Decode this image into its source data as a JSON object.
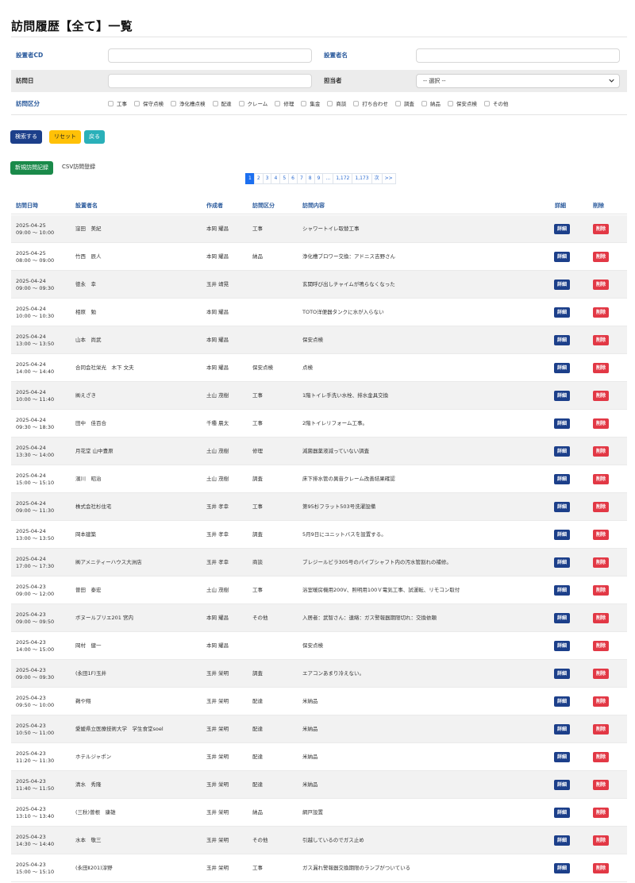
{
  "page": {
    "title": "訪問履歴【全て】一覧"
  },
  "filters": {
    "setter_cd_label": "設置者CD",
    "setter_name_label": "設置者名",
    "visit_date_label": "訪問日",
    "staff_label": "担当者",
    "staff_select": "-- 選択 --",
    "type_label": "訪問区分",
    "types": [
      "工事",
      "保守点検",
      "浄化槽点検",
      "配達",
      "クレーム",
      "修理",
      "集金",
      "商談",
      "打ち合わせ",
      "調査",
      "納品",
      "保安点検",
      "その他"
    ]
  },
  "actions": {
    "search": "検索する",
    "reset": "リセット",
    "back": "戻る",
    "new": "新規訪問記録",
    "csv": "CSV訪問登録"
  },
  "pagination": [
    "1",
    "2",
    "3",
    "4",
    "5",
    "6",
    "7",
    "8",
    "9",
    "...",
    "1,172",
    "1,173",
    "次",
    ">>"
  ],
  "table": {
    "headers": [
      "訪問日時",
      "設置者名",
      "作成者",
      "訪問区分",
      "訪問内容",
      "詳細",
      "削除"
    ],
    "detail_label": "詳細",
    "delete_label": "削除",
    "rows": [
      {
        "date": "2025-04-25",
        "time": "09:00 ～ 10:00",
        "name": "窪田　美紀",
        "author": "本岡 耀昌",
        "type": "工事",
        "content": "シャワートイレ取替工事"
      },
      {
        "date": "2025-04-25",
        "time": "08:00 ～ 09:00",
        "name": "竹西　辰人",
        "author": "本岡 耀昌",
        "type": "納品",
        "content": "浄化槽ブロワー交換：アドニス吉野さん"
      },
      {
        "date": "2025-04-24",
        "time": "09:00 ～ 09:30",
        "name": "徳永　幸",
        "author": "玉井 靖晃",
        "type": "",
        "content": "玄関呼び出しチャイムが鳴らなくなった"
      },
      {
        "date": "2025-04-24",
        "time": "10:00 ～ 10:30",
        "name": "相原　勉",
        "author": "本岡 耀昌",
        "type": "",
        "content": "TOTO洋便器タンクに水が入らない"
      },
      {
        "date": "2025-04-24",
        "time": "13:00 ～ 13:50",
        "name": "山本　尚武",
        "author": "本岡 耀昌",
        "type": "",
        "content": "保安点検"
      },
      {
        "date": "2025-04-24",
        "time": "14:00 ～ 14:40",
        "name": "合同会社栄光　木下 文夫",
        "author": "本岡 耀昌",
        "type": "保安点検",
        "content": "点検"
      },
      {
        "date": "2025-04-24",
        "time": "10:00 ～ 11:40",
        "name": "㈱えざき",
        "author": "土山 茂樹",
        "type": "工事",
        "content": "1階トイレ手洗い水栓、排水金具交換"
      },
      {
        "date": "2025-04-24",
        "time": "09:30 ～ 18:30",
        "name": "田中　佳百合",
        "author": "千種 晨太",
        "type": "工事",
        "content": "2階トイレリフォーム工事。"
      },
      {
        "date": "2025-04-24",
        "time": "13:30 ～ 14:00",
        "name": "月花堂 山中豊原",
        "author": "土山 茂樹",
        "type": "修理",
        "content": "減菌器薬液減っていない調査"
      },
      {
        "date": "2025-04-24",
        "time": "15:00 ～ 15:10",
        "name": "濱川　昭治",
        "author": "土山 茂樹",
        "type": "調査",
        "content": "床下排水管の異音クレーム改善結果確認"
      },
      {
        "date": "2025-04-24",
        "time": "09:00 ～ 11:30",
        "name": "株式会社杉住宅",
        "author": "玉井 孝幸",
        "type": "工事",
        "content": "第95杉フラット503号洗濯設備"
      },
      {
        "date": "2025-04-24",
        "time": "13:00 ～ 13:50",
        "name": "岡本建築",
        "author": "玉井 孝幸",
        "type": "調査",
        "content": "5月9日にユニットバスを設置する。"
      },
      {
        "date": "2025-04-24",
        "time": "17:00 ～ 17:30",
        "name": "㈱アメニティーハウス大洲店",
        "author": "玉井 孝幸",
        "type": "商談",
        "content": "ブレジールビラ305号のパイプシャフト内の汚水管割れの補修。"
      },
      {
        "date": "2025-04-23",
        "time": "09:00 ～ 12:00",
        "name": "曽田　泰宏",
        "author": "土山 茂樹",
        "type": "工事",
        "content": "浴室暖房機用200V、照明用100Ｖ電気工事、試運転、リモコン取付"
      },
      {
        "date": "2025-04-23",
        "time": "09:00 ～ 09:50",
        "name": "ボヌールプリエ201 宮内",
        "author": "本岡 耀昌",
        "type": "その他",
        "content": "入居者：武智さん：連絡：ガス警報器期限切れ：交換依頼"
      },
      {
        "date": "2025-04-23",
        "time": "14:00 ～ 15:00",
        "name": "岡村　健一",
        "author": "本岡 耀昌",
        "type": "",
        "content": "保安点検"
      },
      {
        "date": "2025-04-23",
        "time": "09:00 ～ 09:30",
        "name": "(永田1F)玉井",
        "author": "玉井 栄明",
        "type": "調査",
        "content": "エアコンあまり冷えない。"
      },
      {
        "date": "2025-04-23",
        "time": "09:50 ～ 10:00",
        "name": "鵜や翔",
        "author": "玉井 栄明",
        "type": "配達",
        "content": "米納品"
      },
      {
        "date": "2025-04-23",
        "time": "10:50 ～ 11:00",
        "name": "愛媛県立医療技術大学　学生食堂soel",
        "author": "玉井 栄明",
        "type": "配達",
        "content": "米納品"
      },
      {
        "date": "2025-04-23",
        "time": "11:20 ～ 11:30",
        "name": "ホテルジャポン",
        "author": "玉井 栄明",
        "type": "配達",
        "content": "米納品"
      },
      {
        "date": "2025-04-23",
        "time": "11:40 ～ 11:50",
        "name": "清水　秀隆",
        "author": "玉井 栄明",
        "type": "配達",
        "content": "米納品"
      },
      {
        "date": "2025-04-23",
        "time": "13:10 ～ 13:40",
        "name": "(三秋)曽根　康雄",
        "author": "玉井 栄明",
        "type": "納品",
        "content": "網戸設置"
      },
      {
        "date": "2025-04-23",
        "time": "14:30 ～ 14:40",
        "name": "水本　敬三",
        "author": "玉井 栄明",
        "type": "その他",
        "content": "引越しているのでガス止め"
      },
      {
        "date": "2025-04-23",
        "time": "15:00 ～ 15:10",
        "name": "(永田Ⅱ201)淳野",
        "author": "玉井 栄明",
        "type": "工事",
        "content": "ガス漏れ警報器交換期限のランプがついている"
      }
    ]
  }
}
